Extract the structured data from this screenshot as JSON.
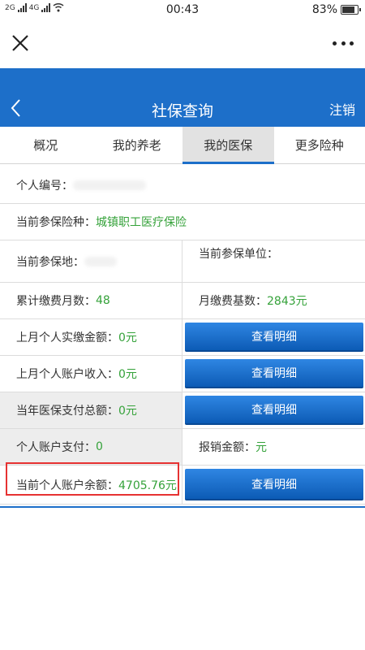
{
  "status_bar": {
    "sim1": "2G",
    "sim2": "4G",
    "time": "00:43",
    "battery": "83%",
    "battery_level": 0.83
  },
  "webview": {
    "close_icon": "close-icon",
    "more_icon": "more-icon"
  },
  "app_nav": {
    "back_icon": "chevron-left-icon",
    "title": "社保查询",
    "logout_label": "注销"
  },
  "tabs": [
    {
      "label": "概况",
      "active": false
    },
    {
      "label": "我的养老",
      "active": false
    },
    {
      "label": "我的医保",
      "active": true
    },
    {
      "label": "更多险种",
      "active": false
    }
  ],
  "info": {
    "personal_id_label": "个人编号：",
    "insurance_type_label": "当前参保险种：",
    "insurance_type_value": "城镇职工医疗保险",
    "location_label": "当前参保地：",
    "employer_label": "当前参保单位：",
    "months_label": "累计缴费月数：",
    "months_value": "48",
    "monthly_base_label": "月缴费基数：",
    "monthly_base_value": "2843元",
    "last_month_paid_label": "上月个人实缴金额：",
    "last_month_paid_value": "0元",
    "last_month_income_label": "上月个人账户收入：",
    "last_month_income_value": "0元",
    "year_total_label": "当年医保支付总额：",
    "year_total_value": "0元",
    "account_pay_label": "个人账户支付：",
    "account_pay_value": "0",
    "reimburse_label": "报销金额：",
    "reimburse_value": "元",
    "balance_label": "当前个人账户余额：",
    "balance_value": "4705.76元",
    "detail_button_label": "查看明细"
  },
  "colors": {
    "brand": "#1d6fc9",
    "value_green": "#35a23a",
    "highlight_red": "#e63232"
  }
}
